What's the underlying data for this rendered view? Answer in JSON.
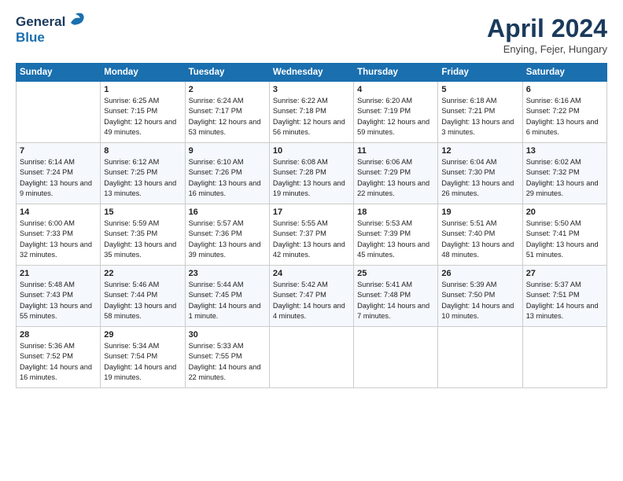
{
  "header": {
    "logo": {
      "general": "General",
      "blue": "Blue"
    },
    "title": "April 2024",
    "subtitle": "Enying, Fejer, Hungary"
  },
  "calendar": {
    "weekdays": [
      "Sunday",
      "Monday",
      "Tuesday",
      "Wednesday",
      "Thursday",
      "Friday",
      "Saturday"
    ],
    "weeks": [
      [
        {
          "day": "",
          "sunrise": "",
          "sunset": "",
          "daylight": ""
        },
        {
          "day": "1",
          "sunrise": "Sunrise: 6:25 AM",
          "sunset": "Sunset: 7:15 PM",
          "daylight": "Daylight: 12 hours and 49 minutes."
        },
        {
          "day": "2",
          "sunrise": "Sunrise: 6:24 AM",
          "sunset": "Sunset: 7:17 PM",
          "daylight": "Daylight: 12 hours and 53 minutes."
        },
        {
          "day": "3",
          "sunrise": "Sunrise: 6:22 AM",
          "sunset": "Sunset: 7:18 PM",
          "daylight": "Daylight: 12 hours and 56 minutes."
        },
        {
          "day": "4",
          "sunrise": "Sunrise: 6:20 AM",
          "sunset": "Sunset: 7:19 PM",
          "daylight": "Daylight: 12 hours and 59 minutes."
        },
        {
          "day": "5",
          "sunrise": "Sunrise: 6:18 AM",
          "sunset": "Sunset: 7:21 PM",
          "daylight": "Daylight: 13 hours and 3 minutes."
        },
        {
          "day": "6",
          "sunrise": "Sunrise: 6:16 AM",
          "sunset": "Sunset: 7:22 PM",
          "daylight": "Daylight: 13 hours and 6 minutes."
        }
      ],
      [
        {
          "day": "7",
          "sunrise": "Sunrise: 6:14 AM",
          "sunset": "Sunset: 7:24 PM",
          "daylight": "Daylight: 13 hours and 9 minutes."
        },
        {
          "day": "8",
          "sunrise": "Sunrise: 6:12 AM",
          "sunset": "Sunset: 7:25 PM",
          "daylight": "Daylight: 13 hours and 13 minutes."
        },
        {
          "day": "9",
          "sunrise": "Sunrise: 6:10 AM",
          "sunset": "Sunset: 7:26 PM",
          "daylight": "Daylight: 13 hours and 16 minutes."
        },
        {
          "day": "10",
          "sunrise": "Sunrise: 6:08 AM",
          "sunset": "Sunset: 7:28 PM",
          "daylight": "Daylight: 13 hours and 19 minutes."
        },
        {
          "day": "11",
          "sunrise": "Sunrise: 6:06 AM",
          "sunset": "Sunset: 7:29 PM",
          "daylight": "Daylight: 13 hours and 22 minutes."
        },
        {
          "day": "12",
          "sunrise": "Sunrise: 6:04 AM",
          "sunset": "Sunset: 7:30 PM",
          "daylight": "Daylight: 13 hours and 26 minutes."
        },
        {
          "day": "13",
          "sunrise": "Sunrise: 6:02 AM",
          "sunset": "Sunset: 7:32 PM",
          "daylight": "Daylight: 13 hours and 29 minutes."
        }
      ],
      [
        {
          "day": "14",
          "sunrise": "Sunrise: 6:00 AM",
          "sunset": "Sunset: 7:33 PM",
          "daylight": "Daylight: 13 hours and 32 minutes."
        },
        {
          "day": "15",
          "sunrise": "Sunrise: 5:59 AM",
          "sunset": "Sunset: 7:35 PM",
          "daylight": "Daylight: 13 hours and 35 minutes."
        },
        {
          "day": "16",
          "sunrise": "Sunrise: 5:57 AM",
          "sunset": "Sunset: 7:36 PM",
          "daylight": "Daylight: 13 hours and 39 minutes."
        },
        {
          "day": "17",
          "sunrise": "Sunrise: 5:55 AM",
          "sunset": "Sunset: 7:37 PM",
          "daylight": "Daylight: 13 hours and 42 minutes."
        },
        {
          "day": "18",
          "sunrise": "Sunrise: 5:53 AM",
          "sunset": "Sunset: 7:39 PM",
          "daylight": "Daylight: 13 hours and 45 minutes."
        },
        {
          "day": "19",
          "sunrise": "Sunrise: 5:51 AM",
          "sunset": "Sunset: 7:40 PM",
          "daylight": "Daylight: 13 hours and 48 minutes."
        },
        {
          "day": "20",
          "sunrise": "Sunrise: 5:50 AM",
          "sunset": "Sunset: 7:41 PM",
          "daylight": "Daylight: 13 hours and 51 minutes."
        }
      ],
      [
        {
          "day": "21",
          "sunrise": "Sunrise: 5:48 AM",
          "sunset": "Sunset: 7:43 PM",
          "daylight": "Daylight: 13 hours and 55 minutes."
        },
        {
          "day": "22",
          "sunrise": "Sunrise: 5:46 AM",
          "sunset": "Sunset: 7:44 PM",
          "daylight": "Daylight: 13 hours and 58 minutes."
        },
        {
          "day": "23",
          "sunrise": "Sunrise: 5:44 AM",
          "sunset": "Sunset: 7:45 PM",
          "daylight": "Daylight: 14 hours and 1 minute."
        },
        {
          "day": "24",
          "sunrise": "Sunrise: 5:42 AM",
          "sunset": "Sunset: 7:47 PM",
          "daylight": "Daylight: 14 hours and 4 minutes."
        },
        {
          "day": "25",
          "sunrise": "Sunrise: 5:41 AM",
          "sunset": "Sunset: 7:48 PM",
          "daylight": "Daylight: 14 hours and 7 minutes."
        },
        {
          "day": "26",
          "sunrise": "Sunrise: 5:39 AM",
          "sunset": "Sunset: 7:50 PM",
          "daylight": "Daylight: 14 hours and 10 minutes."
        },
        {
          "day": "27",
          "sunrise": "Sunrise: 5:37 AM",
          "sunset": "Sunset: 7:51 PM",
          "daylight": "Daylight: 14 hours and 13 minutes."
        }
      ],
      [
        {
          "day": "28",
          "sunrise": "Sunrise: 5:36 AM",
          "sunset": "Sunset: 7:52 PM",
          "daylight": "Daylight: 14 hours and 16 minutes."
        },
        {
          "day": "29",
          "sunrise": "Sunrise: 5:34 AM",
          "sunset": "Sunset: 7:54 PM",
          "daylight": "Daylight: 14 hours and 19 minutes."
        },
        {
          "day": "30",
          "sunrise": "Sunrise: 5:33 AM",
          "sunset": "Sunset: 7:55 PM",
          "daylight": "Daylight: 14 hours and 22 minutes."
        },
        {
          "day": "",
          "sunrise": "",
          "sunset": "",
          "daylight": ""
        },
        {
          "day": "",
          "sunrise": "",
          "sunset": "",
          "daylight": ""
        },
        {
          "day": "",
          "sunrise": "",
          "sunset": "",
          "daylight": ""
        },
        {
          "day": "",
          "sunrise": "",
          "sunset": "",
          "daylight": ""
        }
      ]
    ]
  }
}
